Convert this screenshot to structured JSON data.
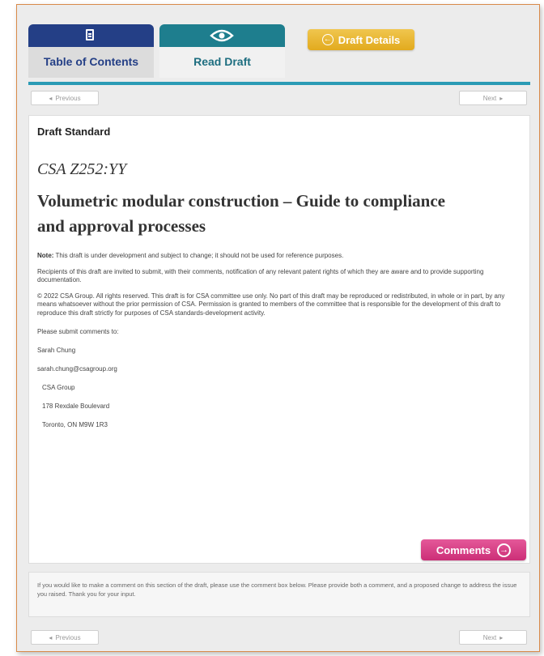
{
  "tabs": {
    "toc_label": "Table of Contents",
    "read_label": "Read Draft",
    "draft_details_label": "Draft Details"
  },
  "nav": {
    "previous_label": "Previous",
    "next_label": "Next"
  },
  "document": {
    "heading": "Draft Standard",
    "code": "CSA Z252:YY",
    "title": "Volumetric modular construction – Guide to compliance and approval processes",
    "note_label": "Note:",
    "note_text": "This draft is under development and subject to change; it should not be used for reference purposes.",
    "recipients_text": "Recipients of this draft are invited to submit, with their comments, notification of any relevant patent rights of which they are aware and to provide supporting documentation.",
    "copyright_text": "© 2022 CSA Group. All rights reserved. This draft is for CSA committee use only. No part of this draft may be reproduced or redistributed, in whole or in part, by any means whatsoever without the prior permission of CSA. Permission is granted to members of the committee that is responsible for the development of this draft to reproduce this draft strictly for purposes of CSA standards-development activity.",
    "submit_text": "Please submit comments to:",
    "contact_name": "Sarah Chung",
    "contact_email": "sarah.chung@csagroup.org",
    "address_org": "CSA Group",
    "address_street": "178 Rexdale Boulevard",
    "address_city": "Toronto, ON M9W 1R3"
  },
  "comments_button_label": "Comments",
  "comment_instructions": "If you would like to make a comment on this section of the draft, please use the comment box below. Please provide both a comment, and a proposed change to address the issue you raised. Thank you for your input.",
  "colors": {
    "toc_tab": "#243f86",
    "read_tab": "#1e7e8e",
    "draft_details": "#e8b42c",
    "comments": "#d63f86",
    "accent_bar": "#2b9bb5",
    "frame_border": "#d98a4a"
  },
  "icons": {
    "toc": "document-icon",
    "read": "eye-icon",
    "draft_details": "arrow-left-circle-icon",
    "comments": "arrow-right-circle-icon"
  }
}
